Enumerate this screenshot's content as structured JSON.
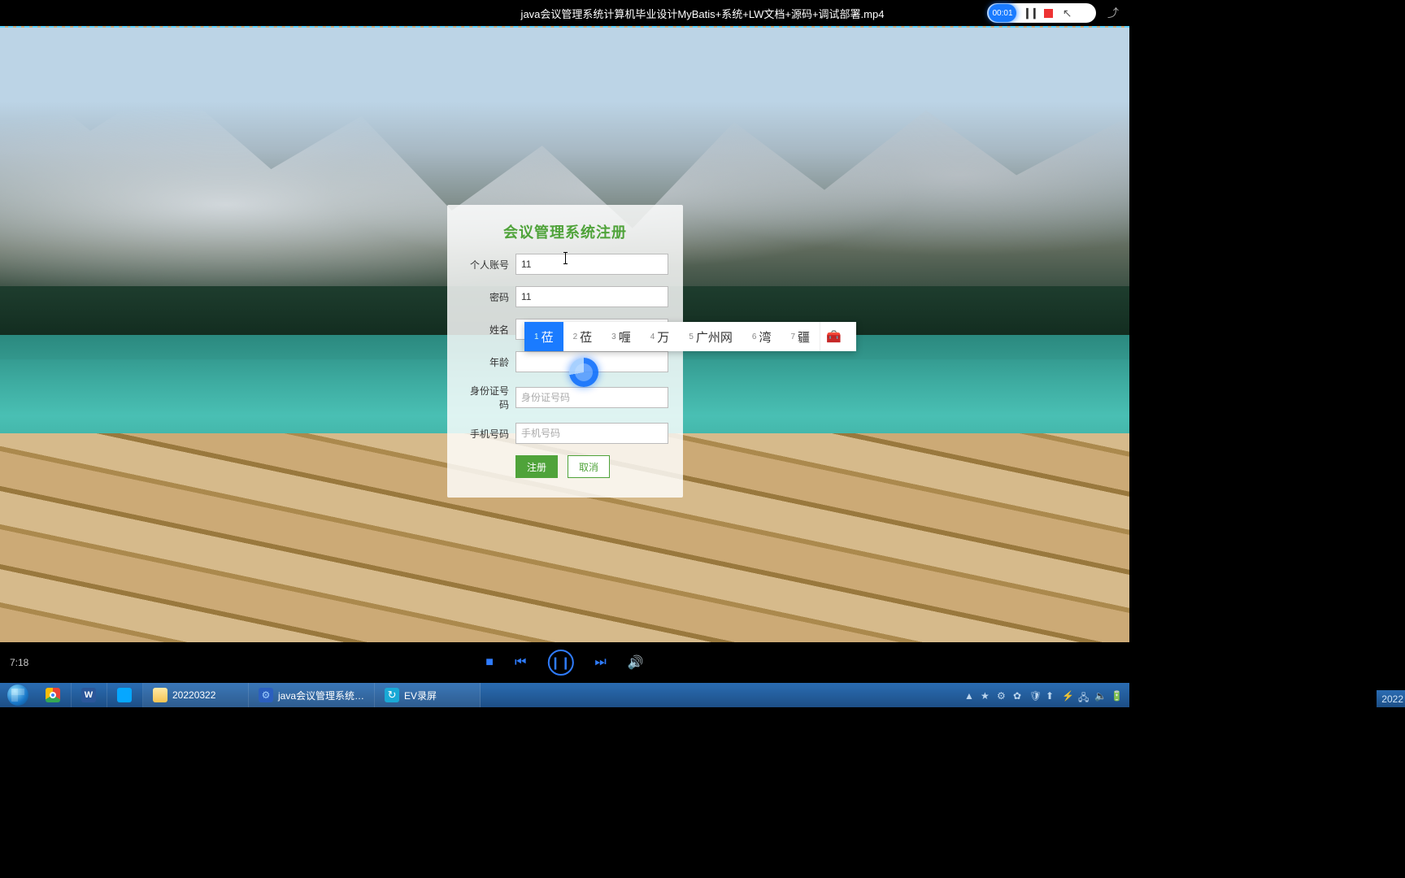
{
  "top": {
    "title": "java会议管理系统计算机毕业设计MyBatis+系统+LW文档+源码+调试部署.mp4",
    "timer": "00:01"
  },
  "reg": {
    "title": "会议管理系统注册",
    "labels": {
      "account": "个人账号",
      "password": "密码",
      "name": "姓名",
      "age": "年龄",
      "idcard": "身份证号码",
      "phone": "手机号码"
    },
    "values": {
      "account": "11",
      "password": "11",
      "name": "",
      "age": "",
      "idcard": "",
      "phone": ""
    },
    "placeholders": {
      "idcard": "身份证号码",
      "phone": "手机号码"
    },
    "buttons": {
      "submit": "注册",
      "cancel": "取消"
    }
  },
  "ime": {
    "candidates": [
      {
        "idx": "1",
        "text": "莅"
      },
      {
        "idx": "2",
        "text": "莅"
      },
      {
        "idx": "3",
        "text": "喱"
      },
      {
        "idx": "4",
        "text": "万"
      },
      {
        "idx": "5",
        "text": "广州网"
      },
      {
        "idx": "6",
        "text": "湾"
      },
      {
        "idx": "7",
        "text": "疆"
      }
    ]
  },
  "player": {
    "current": "7:18"
  },
  "taskbar": {
    "items": [
      {
        "icon": "chrome",
        "label": ""
      },
      {
        "icon": "word",
        "label": ""
      },
      {
        "icon": "baidu",
        "label": ""
      },
      {
        "icon": "folder",
        "label": "20220322"
      },
      {
        "icon": "code",
        "label": "java会议管理系统…"
      },
      {
        "icon": "ev",
        "label": "EV录屏"
      }
    ],
    "clock": "2022"
  }
}
